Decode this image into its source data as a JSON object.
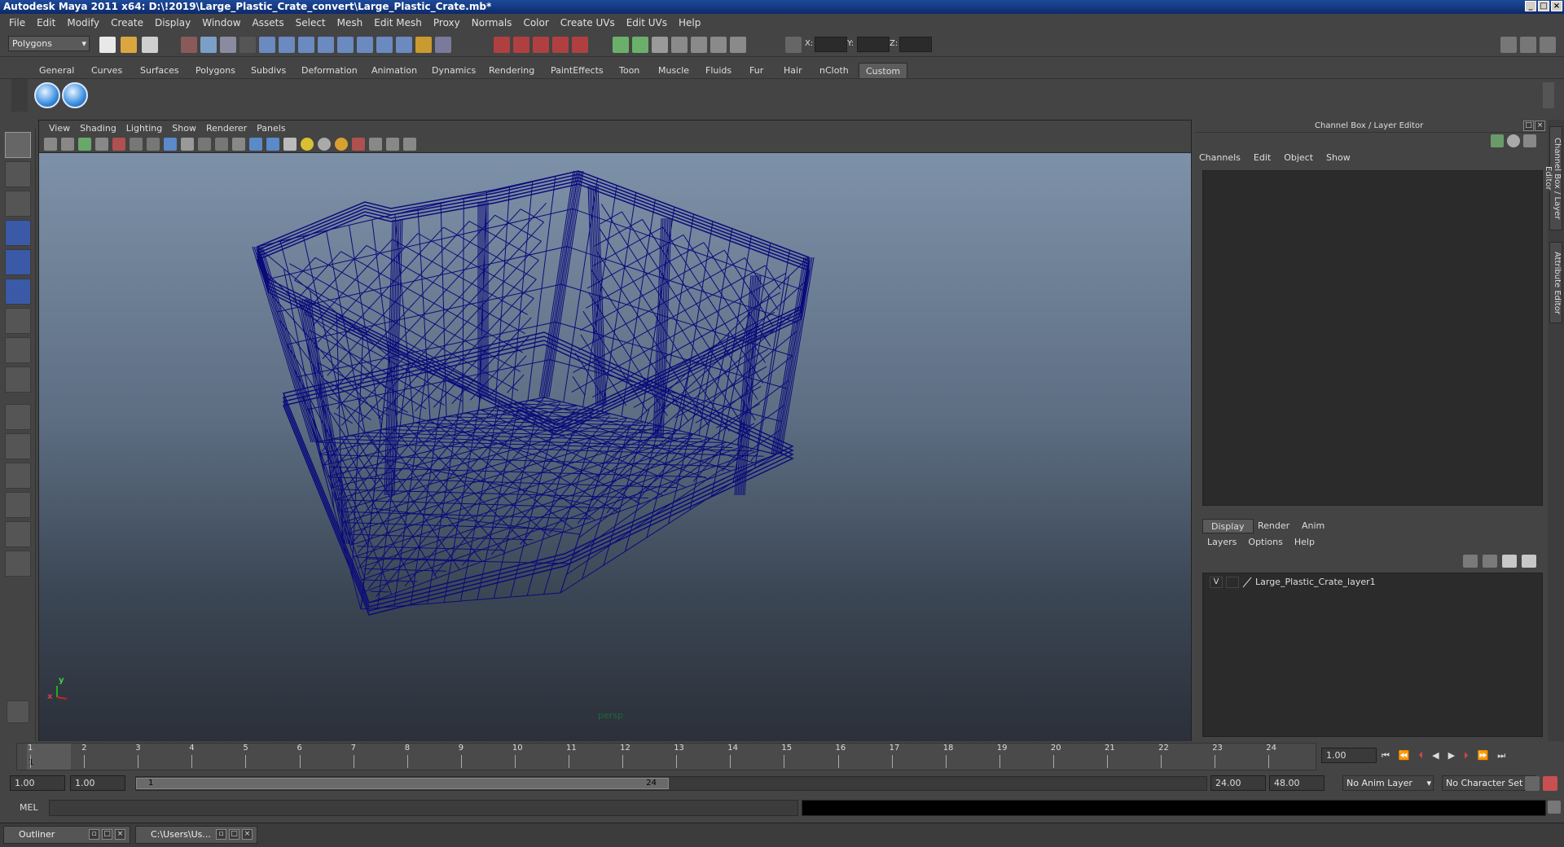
{
  "window": {
    "title": "Autodesk Maya 2011 x64: D:\\!2019\\Large_Plastic_Crate_convert\\Large_Plastic_Crate.mb*"
  },
  "menu": [
    "File",
    "Edit",
    "Modify",
    "Create",
    "Display",
    "Window",
    "Assets",
    "Select",
    "Mesh",
    "Edit Mesh",
    "Proxy",
    "Normals",
    "Color",
    "Create UVs",
    "Edit UVs",
    "Help"
  ],
  "statusline": {
    "mode": "Polygons",
    "x_label": "X:",
    "y_label": "Y:",
    "z_label": "Z:"
  },
  "shelf_tabs": [
    "General",
    "Curves",
    "Surfaces",
    "Polygons",
    "Subdivs",
    "Deformation",
    "Animation",
    "Dynamics",
    "Rendering",
    "PaintEffects",
    "Toon",
    "Muscle",
    "Fluids",
    "Fur",
    "Hair",
    "nCloth",
    "Custom"
  ],
  "active_shelf_tab": "Custom",
  "panel_menu": [
    "View",
    "Shading",
    "Lighting",
    "Show",
    "Renderer",
    "Panels"
  ],
  "viewport": {
    "camera_label": "persp",
    "axis_y": "y",
    "axis_x": "x",
    "wire_color": "#0b0b7a"
  },
  "channel_box": {
    "title": "Channel Box / Layer Editor",
    "menu": [
      "Channels",
      "Edit",
      "Object",
      "Show"
    ]
  },
  "layer_editor": {
    "tabs": [
      "Display",
      "Render",
      "Anim"
    ],
    "active_tab": "Display",
    "menu": [
      "Layers",
      "Options",
      "Help"
    ],
    "layers": [
      {
        "visible": "V",
        "name": "Large_Plastic_Crate_layer1"
      }
    ]
  },
  "side_tabs": [
    "Channel Box / Layer Editor",
    "Attribute Editor"
  ],
  "timeline": {
    "ticks": [
      "1",
      "2",
      "3",
      "4",
      "5",
      "6",
      "7",
      "8",
      "9",
      "10",
      "11",
      "12",
      "13",
      "14",
      "15",
      "16",
      "17",
      "18",
      "19",
      "20",
      "21",
      "22",
      "23",
      "24"
    ],
    "current_frame": "1.00",
    "current_marker": "1"
  },
  "range": {
    "start": "1.00",
    "playback_start": "1.00",
    "slider_start": "1",
    "slider_end": "24",
    "playback_end": "24.00",
    "end": "48.00",
    "anim_layer": "No Anim Layer",
    "character_set": "No Character Set"
  },
  "command_line": {
    "label": "MEL"
  },
  "taskbar": [
    {
      "label": "Outliner"
    },
    {
      "label": "C:\\Users\\Us..."
    }
  ]
}
